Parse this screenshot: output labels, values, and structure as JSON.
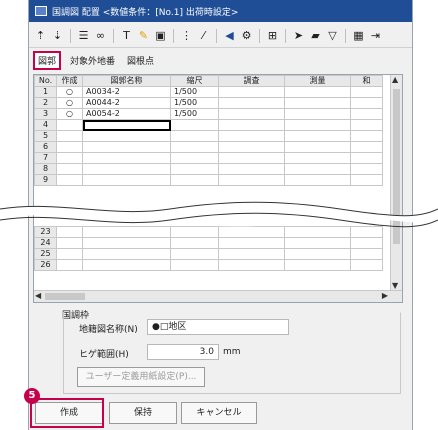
{
  "window": {
    "title": "国調図 配置 <数値条件：[No.1] 出荷時設定>"
  },
  "toolbar": {
    "icons": [
      "sort-asc-icon",
      "sort-desc-icon",
      "list-edit-icon",
      "binoculars-icon",
      "text-edit-icon",
      "color-icon",
      "image-icon",
      "columns-icon",
      "line-tool-icon",
      "speaker-icon",
      "gear-icon",
      "arrange-icon",
      "arrow-tool-icon",
      "fill-icon",
      "filter-icon",
      "table-icon",
      "exit-icon"
    ]
  },
  "tabs": [
    "図郭",
    "対象外地番",
    "図根点"
  ],
  "grid": {
    "headers": [
      "No.",
      "作成",
      "図郭名称",
      "縮尺",
      "調査",
      "測量",
      "和"
    ],
    "rows_top": [
      {
        "no": "1",
        "make": "○",
        "name": "A0034-2",
        "scale": "1/500"
      },
      {
        "no": "2",
        "make": "○",
        "name": "A0044-2",
        "scale": "1/500"
      },
      {
        "no": "3",
        "make": "○",
        "name": "A0054-2",
        "scale": "1/500"
      },
      {
        "no": "4",
        "make": "",
        "name": "",
        "scale": ""
      },
      {
        "no": "5",
        "make": "",
        "name": "",
        "scale": ""
      },
      {
        "no": "6",
        "make": "",
        "name": "",
        "scale": ""
      },
      {
        "no": "7",
        "make": "",
        "name": "",
        "scale": ""
      },
      {
        "no": "8",
        "make": "",
        "name": "",
        "scale": ""
      },
      {
        "no": "9",
        "make": "",
        "name": "",
        "scale": ""
      }
    ],
    "rows_bottom": [
      {
        "no": "23",
        "make": "",
        "name": "",
        "scale": ""
      },
      {
        "no": "24",
        "make": "",
        "name": "",
        "scale": ""
      },
      {
        "no": "25",
        "make": "",
        "name": "",
        "scale": ""
      },
      {
        "no": "26",
        "make": "",
        "name": "",
        "scale": ""
      }
    ]
  },
  "group": {
    "title": "国調枠",
    "map_name_label": "地籍図名称(N)",
    "map_name_value": "●□地区",
    "range_label": "ヒゲ範囲(H)",
    "range_value": "3.0",
    "range_unit": "mm",
    "custom_paper_button": "ユーザー定義用紙設定(P)..."
  },
  "buttons": {
    "create": "作成",
    "hold": "保持",
    "cancel": "キャンセル"
  },
  "step": "5",
  "colors": {
    "accent": "#c7004c",
    "title_bar": "#1f4e96"
  }
}
